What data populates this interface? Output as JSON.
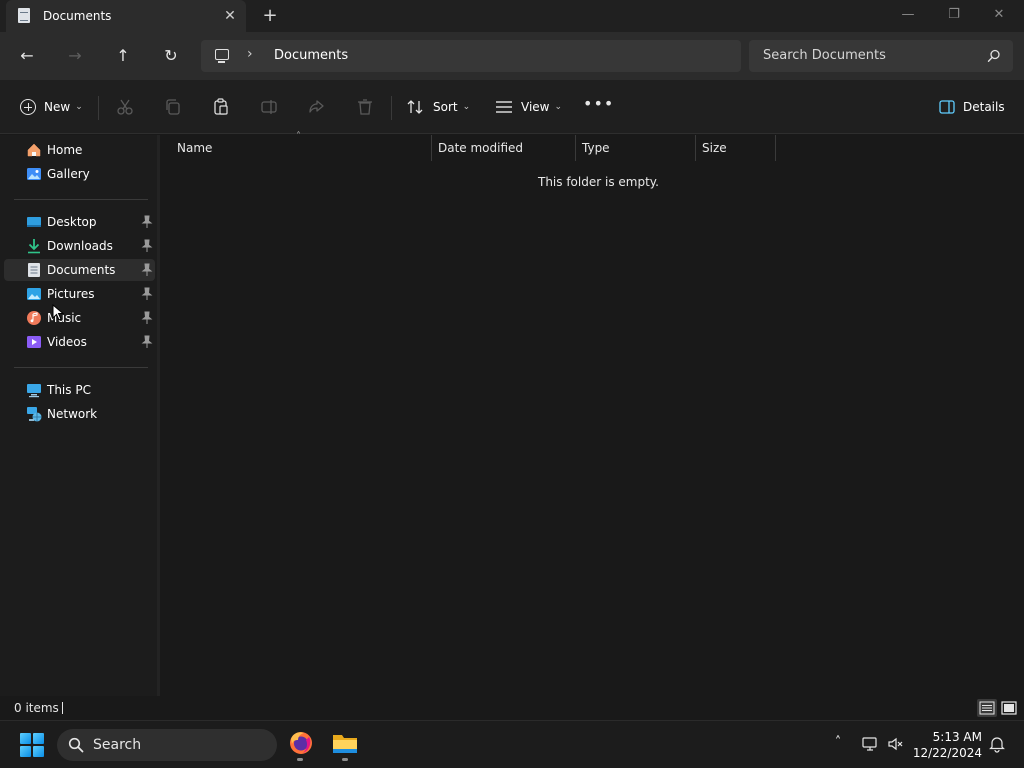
{
  "window": {
    "tab_title": "Documents",
    "tab_close": "✕",
    "new_tab": "+",
    "minimize": "—",
    "maximize": "❐",
    "close": "✕"
  },
  "nav": {
    "back": "←",
    "forward": "→",
    "up": "↑",
    "refresh": "↻",
    "breadcrumb_sep": "›",
    "breadcrumb": "Documents",
    "search_placeholder": "Search Documents"
  },
  "toolbar": {
    "new_label": "New",
    "caret": "⌄",
    "sort_label": "Sort",
    "view_label": "View",
    "more": "•••",
    "details_label": "Details"
  },
  "sidebar": {
    "items": [
      {
        "label": "Home",
        "icon": "home-icon"
      },
      {
        "label": "Gallery",
        "icon": "gallery-icon"
      },
      {
        "label": "Desktop",
        "icon": "desktop-icon",
        "pinned": true
      },
      {
        "label": "Downloads",
        "icon": "downloads-icon",
        "pinned": true
      },
      {
        "label": "Documents",
        "icon": "documents-icon",
        "pinned": true,
        "selected": true
      },
      {
        "label": "Pictures",
        "icon": "pictures-icon",
        "pinned": true
      },
      {
        "label": "Music",
        "icon": "music-icon",
        "pinned": true
      },
      {
        "label": "Videos",
        "icon": "videos-icon",
        "pinned": true
      },
      {
        "label": "This PC",
        "icon": "this-pc-icon"
      },
      {
        "label": "Network",
        "icon": "network-icon"
      }
    ]
  },
  "content": {
    "columns": [
      "Name",
      "Date modified",
      "Type",
      "Size"
    ],
    "sort_indicator": "˄",
    "empty_message": "This folder is empty."
  },
  "status": {
    "items_count": "0 items"
  },
  "taskbar": {
    "search_label": "Search",
    "chevron": "˄",
    "time": "5:13 AM",
    "date": "12/22/2024"
  },
  "colors": {
    "accent": "#60cdff",
    "background": "#191919",
    "chrome": "#2c2c2c"
  }
}
